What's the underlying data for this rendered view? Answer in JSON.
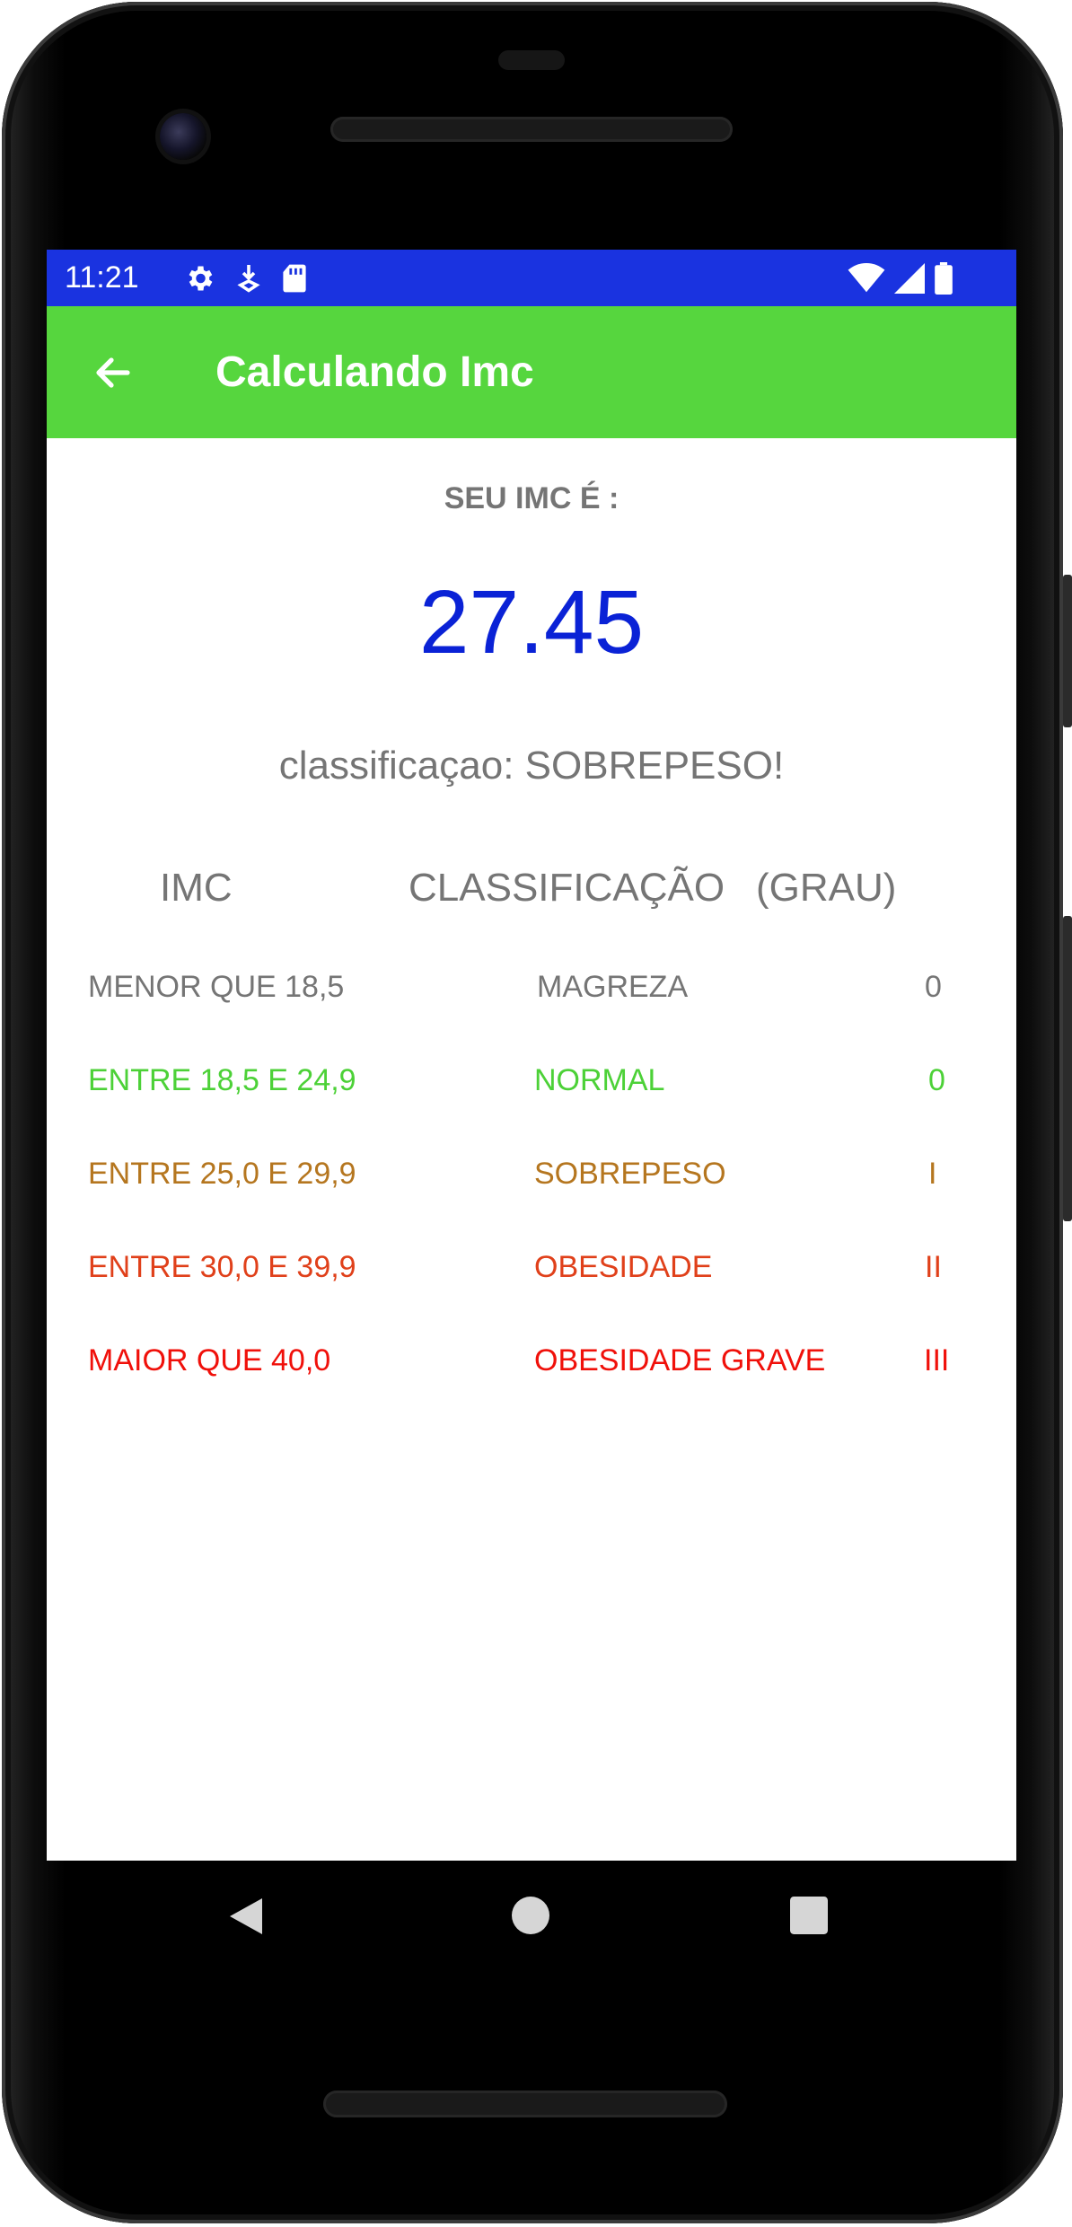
{
  "status_bar": {
    "time": "11:21",
    "background": "#1a33e0",
    "icons_left": [
      "gear-icon",
      "download-icon",
      "sd-card-icon"
    ],
    "icons_right": [
      "wifi-icon",
      "signal-icon",
      "battery-icon"
    ]
  },
  "app_bar": {
    "title": "Calculando Imc",
    "background": "#56d63e",
    "back_icon": "arrow-left-icon"
  },
  "result": {
    "label": "SEU IMC É :",
    "value": "27.45",
    "value_color": "#0a22d6",
    "classification": "classificaçao: SOBREPESO!"
  },
  "table": {
    "headers": {
      "imc": "IMC",
      "classification": "CLASSIFICAÇÃO",
      "grade": "(GRAU)"
    },
    "rows": [
      {
        "range": "MENOR QUE  18,5",
        "classification": "MAGREZA",
        "grade": "0",
        "color": "#757575"
      },
      {
        "range": "ENTRE 18,5 E 24,9",
        "classification": "NORMAL",
        "grade": "0",
        "color": "#4cd137"
      },
      {
        "range": "ENTRE 25,0 E 29,9",
        "classification": "SOBREPESO",
        "grade": "I",
        "color": "#b5761f"
      },
      {
        "range": "ENTRE 30,0 E 39,9",
        "classification": "OBESIDADE",
        "grade": "II",
        "color": "#e0401a"
      },
      {
        "range": "MAIOR QUE 40,0",
        "classification": "OBESIDADE GRAVE",
        "grade": "III",
        "color": "#f0100a"
      }
    ]
  },
  "nav_bar": {
    "buttons": [
      "back-triangle-icon",
      "home-circle-icon",
      "recents-square-icon"
    ]
  }
}
